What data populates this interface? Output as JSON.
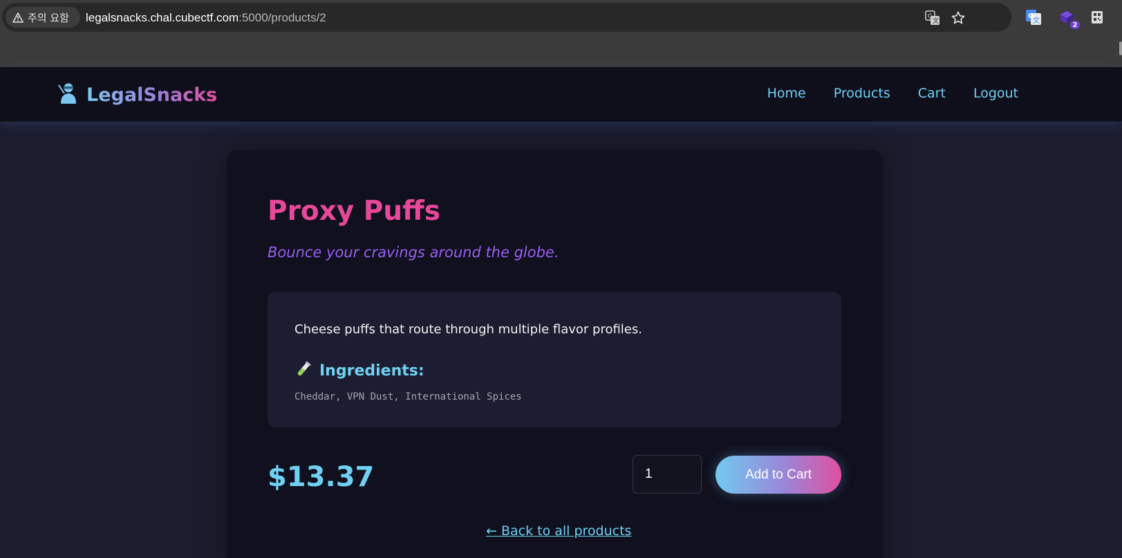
{
  "browser": {
    "security_label": "주의 요함",
    "url_host": "legalsnacks.chal.cubectf.com",
    "url_rest": ":5000/products/2",
    "extension_badge": "2",
    "icons": [
      "warning-icon",
      "translate-icon",
      "bookmark-star-icon",
      "google-translate-extension-icon",
      "extension-icon",
      "qr-extension-icon"
    ]
  },
  "header": {
    "brand": "LegalSnacks",
    "nav": [
      "Home",
      "Products",
      "Cart",
      "Logout"
    ],
    "nav_color": "#6fd0f2"
  },
  "product": {
    "name": "Proxy Puffs",
    "tagline": "Bounce your cravings around the globe.",
    "description": "Cheese puffs that route through multiple flavor profiles.",
    "ingredients_label": "Ingredients:",
    "ingredients": "Cheddar, VPN Dust, International Spices",
    "price": "$13.37",
    "quantity": "1",
    "add_to_cart_label": "Add to Cart",
    "back_link": "← Back to all products"
  },
  "colors": {
    "accent_pink": "#e8489a",
    "accent_purple": "#9a5ef0",
    "accent_cyan": "#6fd0f2",
    "background": "#1c1c2e",
    "card": "#10101e"
  }
}
